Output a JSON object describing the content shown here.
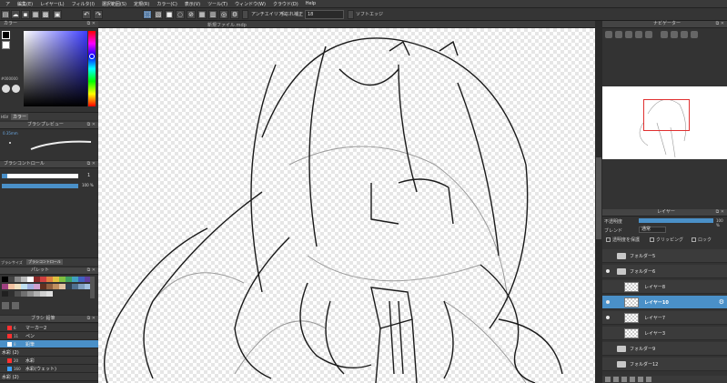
{
  "menu": [
    "ア",
    "編集(E)",
    "レイヤー(L)",
    "フィルタ(I)",
    "選択範囲(S)",
    "定規(R)",
    "カラー(C)",
    "表示(V)",
    "ツール(T)",
    "ウィンドウ(W)",
    "クラウド(D)",
    "Help"
  ],
  "toolbar": {
    "antialias_label": "アンチエイリアス",
    "stabilizer_label": "手ぶれ補正",
    "stabilizer_value": "18",
    "soft_edge_label": "ソフトエッジ",
    "undo_icon": "undo-icon",
    "redo_icon": "redo-icon"
  },
  "color_panel": {
    "title": "カラー",
    "hex_value": "#000000",
    "tab_label": "カラー",
    "hsv_label": "HSV",
    "accent": "#3d3dff"
  },
  "brush_preview": {
    "title": "ブラシプレビュー",
    "size_label": "0.35mm"
  },
  "brush_control": {
    "title": "ブラシコントロール",
    "size_value": "1",
    "opacity_value": "100 %",
    "tab_size": "ブラシサイズ",
    "tab_control": "ブラシコントロール"
  },
  "palette": {
    "title": "パレット"
  },
  "brush_list": {
    "title": "ブラシ 鉛筆",
    "items": [
      {
        "num": "6",
        "name": "マーカー2",
        "color": "#ff3030"
      },
      {
        "num": "11",
        "name": "ペン",
        "color": "#ff3030"
      },
      {
        "num": "8",
        "name": "鉛筆",
        "color": "#ffffff"
      },
      {
        "num": "",
        "name": "水彩 (2)",
        "color": ""
      },
      {
        "num": "20",
        "name": "水彩",
        "color": "#ff3030"
      },
      {
        "num": "160",
        "name": "水彩(ウェット)",
        "color": "#3aa0ff"
      },
      {
        "num": "",
        "name": "水彩 (2)",
        "color": ""
      }
    ]
  },
  "canvas": {
    "title": "新規ファイル.mdp"
  },
  "navigator": {
    "title": "ナビゲーター"
  },
  "layers": {
    "title": "レイヤー",
    "opacity_label": "不透明度",
    "opacity_value": "100 %",
    "blend_label": "ブレンド",
    "blend_value": "通常",
    "protect_alpha": "透明度を保護",
    "clipping": "クリッピング",
    "lock": "ロック",
    "items": [
      {
        "name": "フォルダー5",
        "kind": "folder",
        "visible": false,
        "selected": false
      },
      {
        "name": "フォルダー6",
        "kind": "folder",
        "visible": true,
        "selected": false
      },
      {
        "name": "レイヤー8",
        "kind": "layer",
        "visible": false,
        "selected": false
      },
      {
        "name": "レイヤー10",
        "kind": "layer",
        "visible": true,
        "selected": true
      },
      {
        "name": "レイヤー7",
        "kind": "layer",
        "visible": true,
        "selected": false
      },
      {
        "name": "レイヤー3",
        "kind": "layer",
        "visible": false,
        "selected": false
      },
      {
        "name": "フォルダー9",
        "kind": "folder",
        "visible": false,
        "selected": false
      },
      {
        "name": "フォルダー12",
        "kind": "folder",
        "visible": false,
        "selected": false
      }
    ]
  }
}
